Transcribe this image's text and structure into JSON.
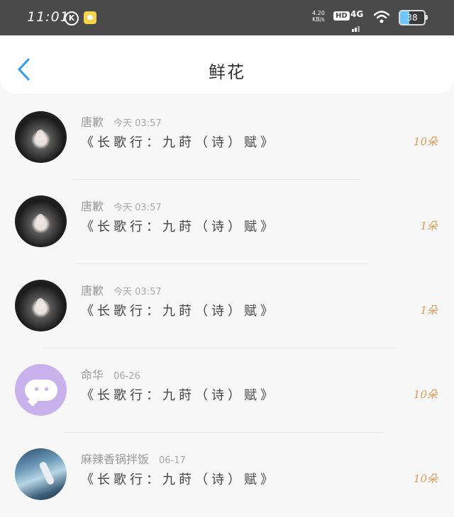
{
  "status_bar": {
    "time": "11:01",
    "k_icon": "K",
    "net_speed_value": "4.20",
    "net_speed_unit": "KB/s",
    "hd": "HD",
    "network": "4G",
    "battery": "38"
  },
  "header": {
    "title": "鲜花"
  },
  "items": [
    {
      "name": "唐歉",
      "time": "今天 03:57",
      "work": "《长歌行：九莳（诗）赋》",
      "count": "10朵",
      "avatar": "portrait-photo"
    },
    {
      "name": "唐歉",
      "time": "今天 03:57",
      "work": "《长歌行：九莳（诗）赋》",
      "count": "1朵",
      "avatar": "portrait-photo"
    },
    {
      "name": "唐歉",
      "time": "今天 03:57",
      "work": "《长歌行：九莳（诗）赋》",
      "count": "1朵",
      "avatar": "portrait-photo"
    },
    {
      "name": "命华",
      "time": "06-26",
      "work": "《长歌行：九莳（诗）赋》",
      "count": "10朵",
      "avatar": "chat-bubble"
    },
    {
      "name": "麻辣香锅拌饭",
      "time": "06-17",
      "work": "《长歌行：九莳（诗）赋》",
      "count": "10朵",
      "avatar": "scene-photo"
    }
  ],
  "colors": {
    "accent_blue": "#2d9bf0",
    "count_orange": "#e09a55",
    "status_bar": "#4a4a4a"
  }
}
